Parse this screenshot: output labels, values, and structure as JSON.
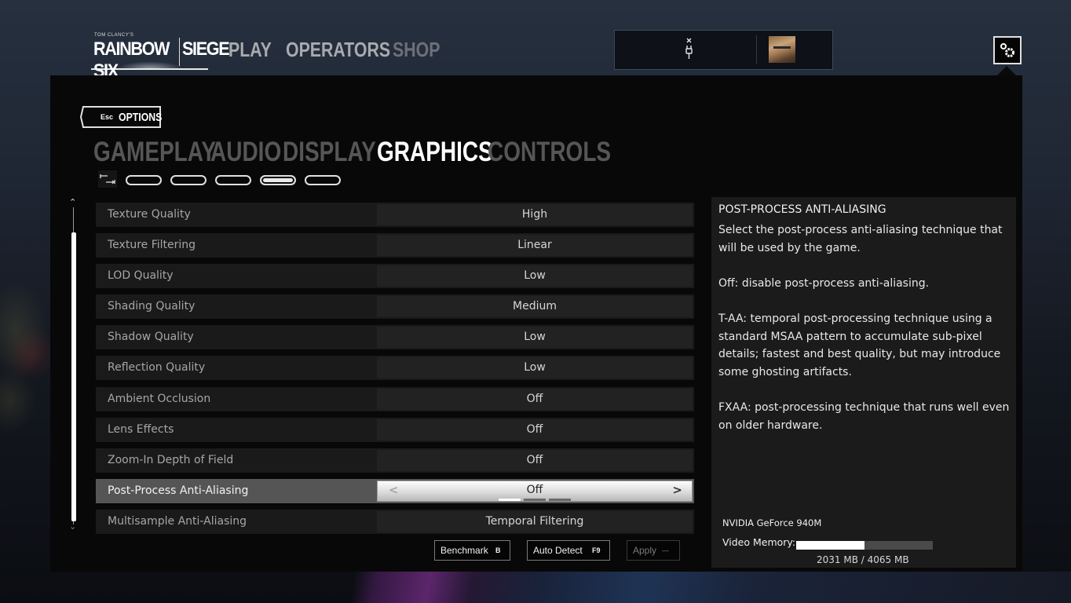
{
  "header": {
    "logo_small": "TOM CLANCY'S",
    "logo_main": "RAINBOW SIX SIEGE",
    "nav": [
      {
        "label": "PLAY"
      },
      {
        "label": "OPERATORS"
      },
      {
        "label": "SHOP"
      }
    ],
    "status_icon": "disconnected-plug-icon",
    "avatar": "operator-avatar",
    "settings_icon": "gears-icon"
  },
  "options": {
    "back_key": "Esc",
    "back_label": "OPTIONS",
    "tabs": [
      {
        "label": "GAMEPLAY",
        "active": false
      },
      {
        "label": "AUDIO",
        "active": false
      },
      {
        "label": "DISPLAY",
        "active": false
      },
      {
        "label": "GRAPHICS",
        "active": true
      },
      {
        "label": "CONTROLS",
        "active": false
      }
    ],
    "subpages": {
      "count": 5,
      "active_index": 3,
      "icon": "toggle-arrows-icon"
    }
  },
  "settings": [
    {
      "label": "Texture Quality",
      "value": "High"
    },
    {
      "label": "Texture Filtering",
      "value": "Linear"
    },
    {
      "label": "LOD Quality",
      "value": "Low"
    },
    {
      "label": "Shading Quality",
      "value": "Medium"
    },
    {
      "label": "Shadow Quality",
      "value": "Low"
    },
    {
      "label": "Reflection Quality",
      "value": "Low"
    },
    {
      "label": "Ambient Occlusion",
      "value": "Off"
    },
    {
      "label": "Lens Effects",
      "value": "Off"
    },
    {
      "label": "Zoom-In Depth of Field",
      "value": "Off"
    },
    {
      "label": "Post-Process Anti-Aliasing",
      "value": "Off",
      "selected": true,
      "option_count": 3,
      "option_index": 0
    },
    {
      "label": "Multisample Anti-Aliasing",
      "value": "Temporal Filtering"
    }
  ],
  "buttons": {
    "benchmark": {
      "label": "Benchmark",
      "key": "B"
    },
    "auto_detect": {
      "label": "Auto Detect",
      "key": "F9"
    },
    "apply": {
      "label": "Apply",
      "key": "—",
      "enabled": false
    }
  },
  "info": {
    "title": "POST-PROCESS ANTI-ALIASING",
    "body": "Select the post-process anti-aliasing technique that will be used by the game.\n\nOff: disable post-process anti-aliasing.\n\nT-AA: temporal post-processing technique using a standard MSAA pattern to accumulate sub-pixel details; fastest and best quality, but may introduce some ghosting artifacts.\n\nFXAA: post-processing technique that runs well even on older hardware.",
    "gpu_name": "NVIDIA GeForce 940M",
    "vram_label": "Video Memory:",
    "vram_used_mb": 2031,
    "vram_total_mb": 4065,
    "vram_text": "2031 MB / 4065 MB"
  }
}
